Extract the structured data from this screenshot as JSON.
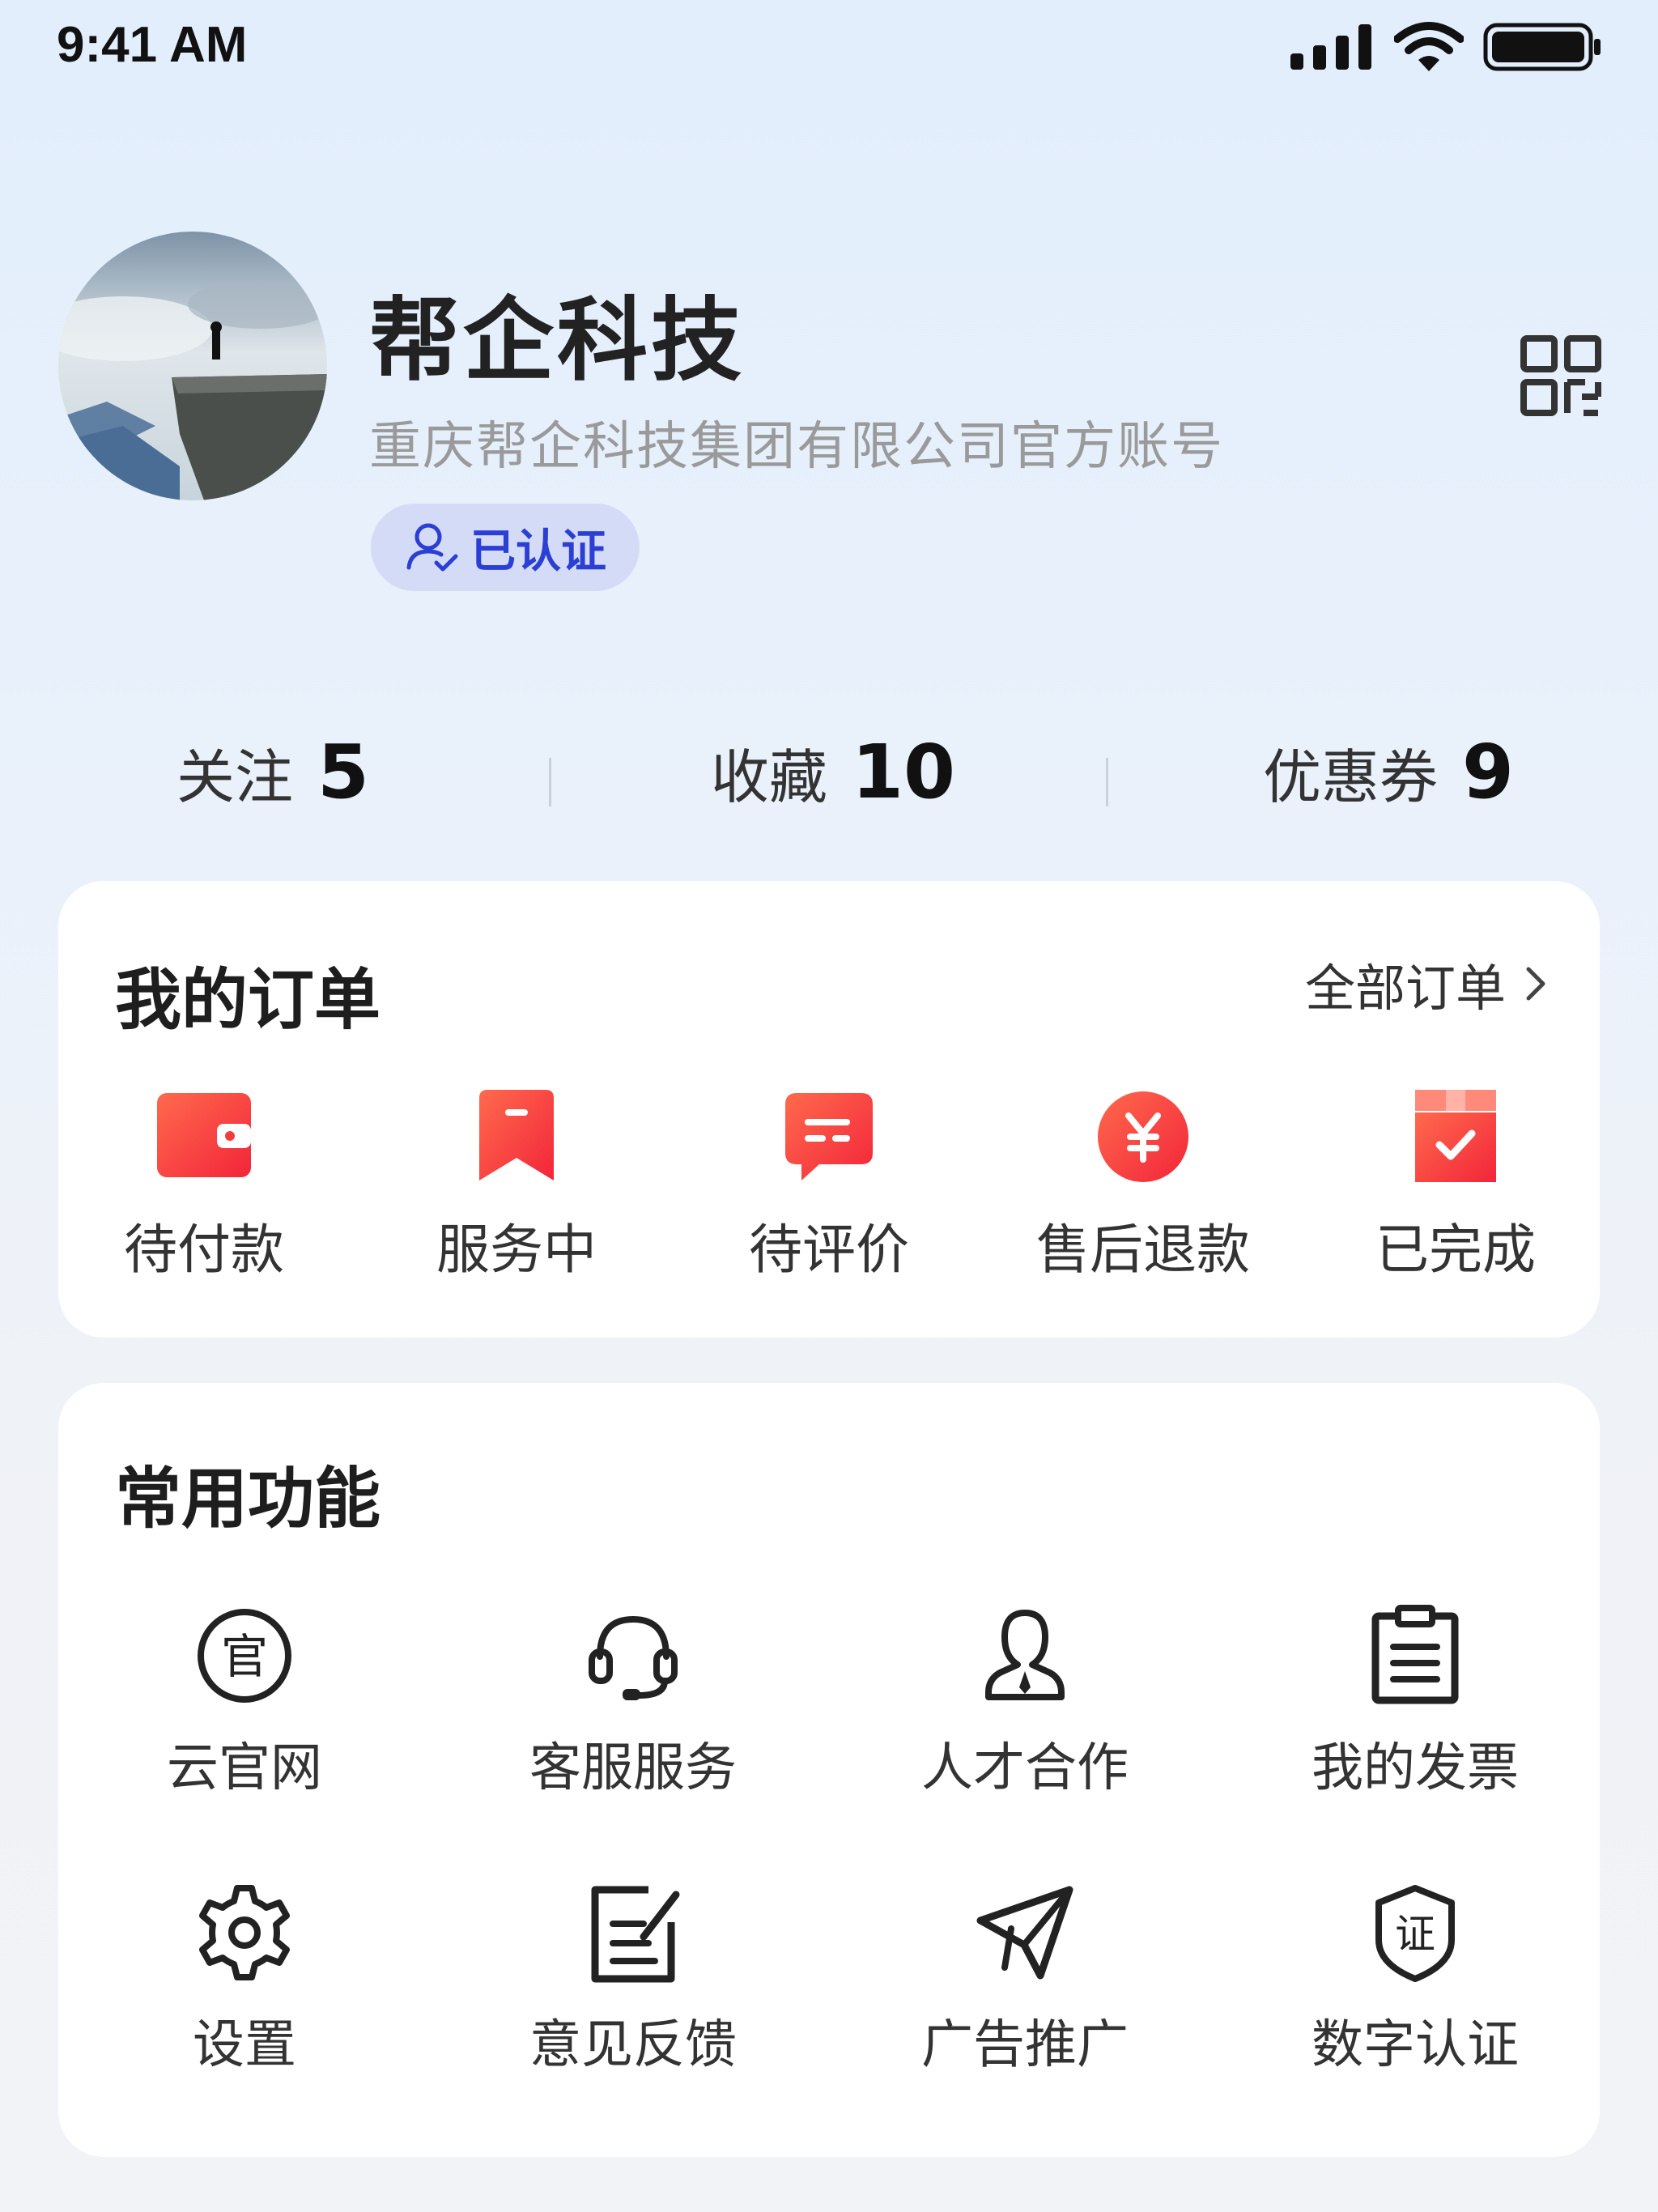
{
  "status_bar": {
    "time": "9:41 AM"
  },
  "profile": {
    "name": "帮企科技",
    "subtitle": "重庆帮企科技集团有限公司官方账号",
    "verified_label": "已认证"
  },
  "stats": [
    {
      "label": "关注",
      "value": "5"
    },
    {
      "label": "收藏",
      "value": "10"
    },
    {
      "label": "优惠券",
      "value": "9"
    }
  ],
  "orders": {
    "title": "我的订单",
    "all_label": "全部订单",
    "items": [
      {
        "label": "待付款",
        "icon": "wallet-icon"
      },
      {
        "label": "服务中",
        "icon": "bookmark-icon"
      },
      {
        "label": "待评价",
        "icon": "message-icon"
      },
      {
        "label": "售后退款",
        "icon": "yen-icon"
      },
      {
        "label": "已完成",
        "icon": "box-check-icon"
      }
    ]
  },
  "functions": {
    "title": "常用功能",
    "items": [
      {
        "label": "云官网",
        "icon": "official-site-icon",
        "glyph": "官"
      },
      {
        "label": "客服服务",
        "icon": "headset-icon"
      },
      {
        "label": "人才合作",
        "icon": "person-icon"
      },
      {
        "label": "我的发票",
        "icon": "invoice-icon"
      },
      {
        "label": "设置",
        "icon": "gear-icon"
      },
      {
        "label": "意见反馈",
        "icon": "feedback-icon"
      },
      {
        "label": "广告推广",
        "icon": "paper-plane-icon"
      },
      {
        "label": "数字认证",
        "icon": "certificate-shield-icon",
        "glyph": "证"
      }
    ]
  },
  "colors": {
    "accent_red": "#f33d3d",
    "verified_bg": "#d4dbf7",
    "verified_text": "#2b3fd4"
  }
}
